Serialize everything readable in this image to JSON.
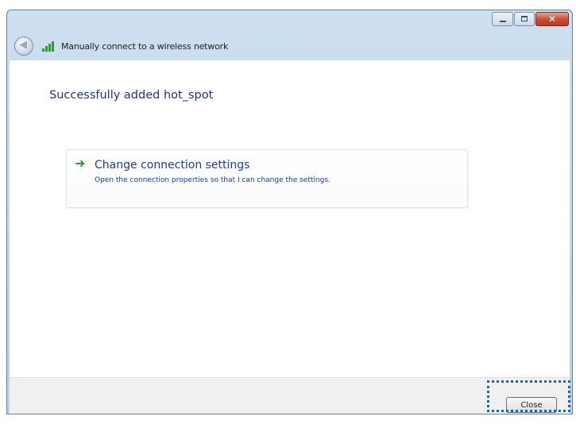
{
  "window": {
    "title": "Manually connect to a wireless network",
    "controls": {
      "minimize_icon": "minimize-icon",
      "maximize_icon": "maximize-icon",
      "close_glyph": "✕"
    }
  },
  "nav": {
    "back_icon": "back-arrow-icon",
    "back_glyph": "◀"
  },
  "main": {
    "heading": "Successfully added hot_spot",
    "option": {
      "icon": "green-arrow-icon",
      "glyph": "➜",
      "title": "Change connection settings",
      "description": "Open the connection properties so that I can change the settings."
    }
  },
  "footer": {
    "close_label": "Close"
  },
  "colors": {
    "link": "#1f3a9a",
    "heading": "#1e3287",
    "accent_green": "#2b9a3c",
    "highlight": "#1f5fbd"
  }
}
